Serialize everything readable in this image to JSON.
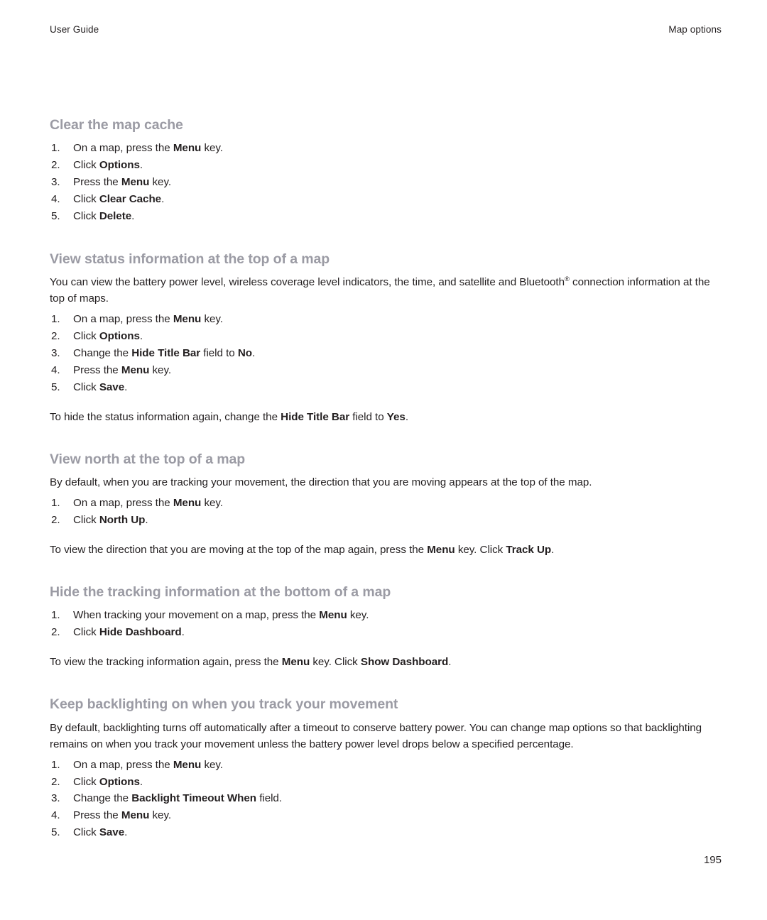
{
  "running_head": {
    "left": "User Guide",
    "right": "Map options"
  },
  "folio": "195",
  "sections": [
    {
      "title": "Clear the map cache",
      "intro": null,
      "steps": [
        {
          "num": "1.",
          "pre": "On a map, press the ",
          "bold": "Menu",
          "post": " key."
        },
        {
          "num": "2.",
          "pre": "Click ",
          "bold": "Options",
          "post": "."
        },
        {
          "num": "3.",
          "pre": "Press the ",
          "bold": "Menu",
          "post": " key."
        },
        {
          "num": "4.",
          "pre": "Click ",
          "bold": "Clear Cache",
          "post": "."
        },
        {
          "num": "5.",
          "pre": "Click ",
          "bold": "Delete",
          "post": "."
        }
      ],
      "note": null
    },
    {
      "title": "View status information at the top of a map",
      "intro_pre": "You can view the battery power level, wireless coverage level indicators, the time, and satellite and Bluetooth",
      "intro_sup": "®",
      "intro_post": " connection information at the top of maps.",
      "steps": [
        {
          "num": "1.",
          "pre": "On a map, press the ",
          "bold": "Menu",
          "post": " key."
        },
        {
          "num": "2.",
          "pre": "Click ",
          "bold": "Options",
          "post": "."
        },
        {
          "num": "3.",
          "pre": "Change the ",
          "bold": "Hide Title Bar",
          "mid": " field to ",
          "bold2": "No",
          "post": "."
        },
        {
          "num": "4.",
          "pre": "Press the ",
          "bold": "Menu",
          "post": " key."
        },
        {
          "num": "5.",
          "pre": "Click ",
          "bold": "Save",
          "post": "."
        }
      ],
      "note_pre": "To hide the status information again, change the ",
      "note_bold": "Hide Title Bar",
      "note_mid": " field to ",
      "note_bold2": "Yes",
      "note_post": "."
    },
    {
      "title": "View north at the top of a map",
      "intro": "By default, when you are tracking your movement, the direction that you are moving appears at the top of the map.",
      "steps": [
        {
          "num": "1.",
          "pre": "On a map, press the ",
          "bold": "Menu",
          "post": " key."
        },
        {
          "num": "2.",
          "pre": "Click ",
          "bold": "North Up",
          "post": "."
        }
      ],
      "note_pre": "To view the direction that you are moving at the top of the map again, press the ",
      "note_bold": "Menu",
      "note_mid": " key. Click ",
      "note_bold2": "Track Up",
      "note_post": "."
    },
    {
      "title": "Hide the tracking information at the bottom of a map",
      "intro": null,
      "steps": [
        {
          "num": "1.",
          "pre": "When tracking your movement on a map, press the ",
          "bold": "Menu",
          "post": " key."
        },
        {
          "num": "2.",
          "pre": "Click ",
          "bold": "Hide Dashboard",
          "post": "."
        }
      ],
      "note_pre": "To view the tracking information again, press the ",
      "note_bold": "Menu",
      "note_mid": " key. Click ",
      "note_bold2": "Show Dashboard",
      "note_post": "."
    },
    {
      "title": "Keep backlighting on when you track your movement",
      "intro": "By default, backlighting turns off automatically after a timeout to conserve battery power. You can change map options so that backlighting remains on when you track your movement unless the battery power level drops below a specified percentage.",
      "steps": [
        {
          "num": "1.",
          "pre": "On a map, press the ",
          "bold": "Menu",
          "post": " key."
        },
        {
          "num": "2.",
          "pre": "Click ",
          "bold": "Options",
          "post": "."
        },
        {
          "num": "3.",
          "pre": "Change the ",
          "bold": "Backlight Timeout When",
          "post": " field."
        },
        {
          "num": "4.",
          "pre": "Press the ",
          "bold": "Menu",
          "post": " key."
        },
        {
          "num": "5.",
          "pre": "Click ",
          "bold": "Save",
          "post": "."
        }
      ],
      "note": null
    }
  ],
  "colors": {
    "heading": "#9b9ba4",
    "body": "#231f20",
    "page_background": "#ffffff"
  }
}
